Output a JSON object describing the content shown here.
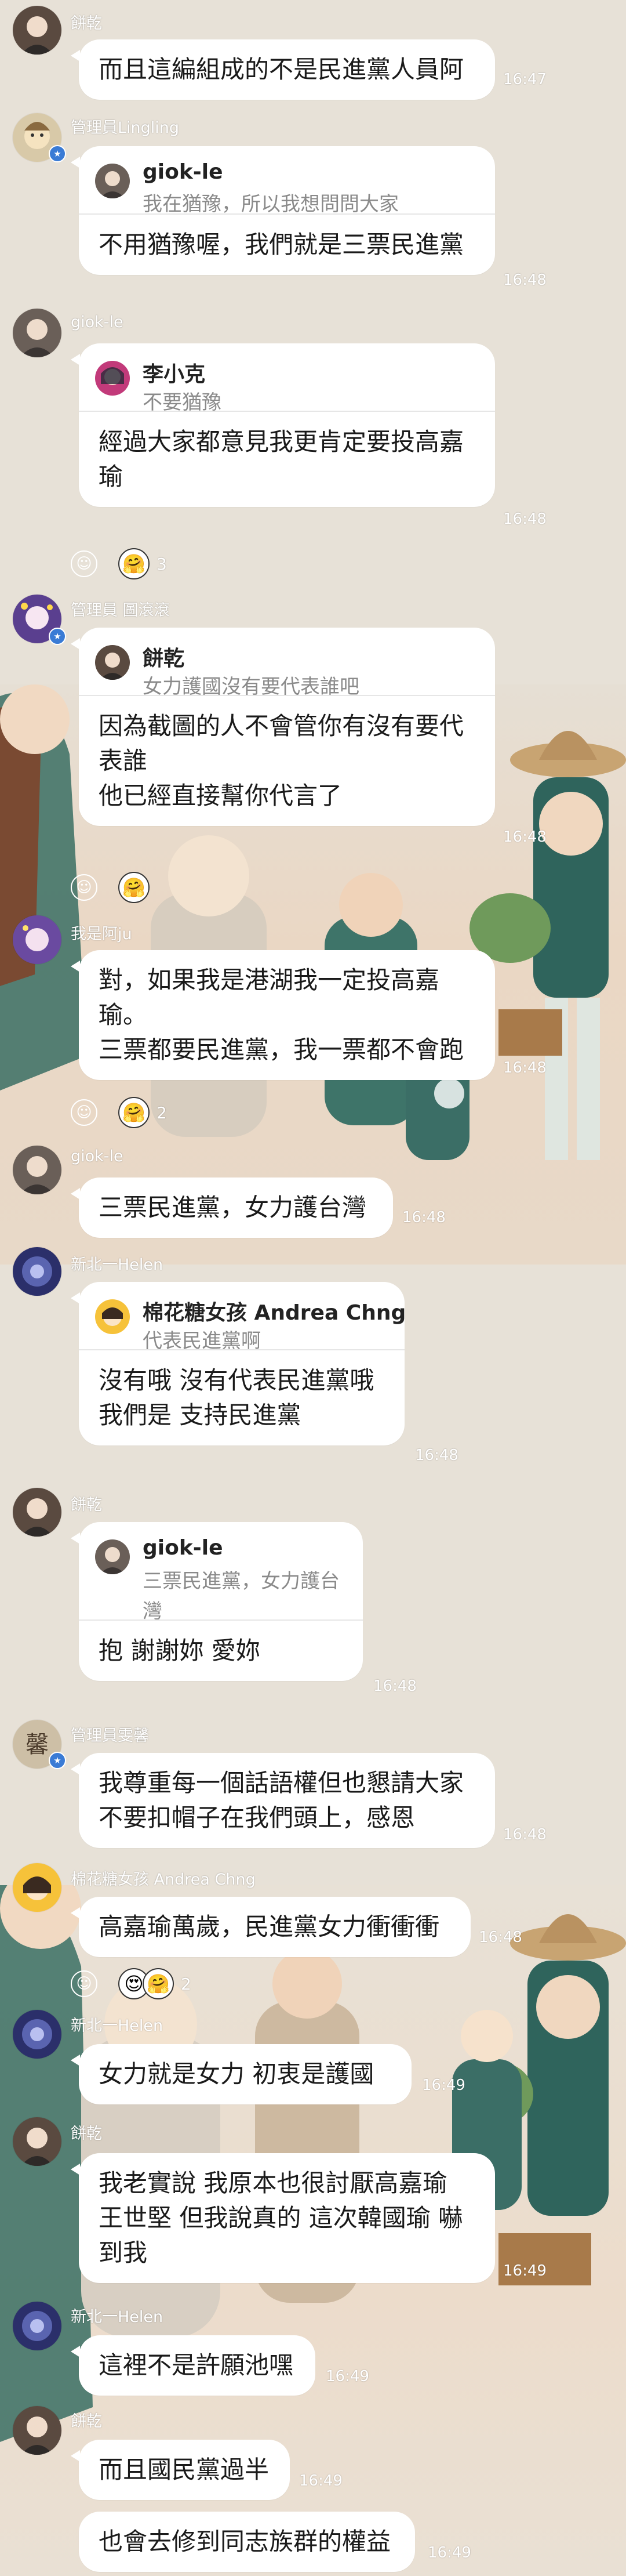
{
  "messages": [
    {
      "sender": "餅乾",
      "text": "而且這編組成的不是民進黨人員阿",
      "time": "16:47"
    },
    {
      "sender": "管理員Lingling",
      "reply": {
        "name": "giok-le",
        "text": "我在猶豫，所以我想問問大家"
      },
      "text": "不用猶豫喔，我們就是三票民進黨",
      "time": "16:48"
    },
    {
      "sender": "giok-le",
      "reply": {
        "name": "李小克",
        "text": "不要猶豫"
      },
      "text": "經過大家都意見我更肯定要投高嘉\n瑜",
      "time": "16:48",
      "reaction_count": "3"
    },
    {
      "sender": "管理員 圖滾滾",
      "reply": {
        "name": "餅乾",
        "text": "女力護國沒有要代表誰吧"
      },
      "text": "因為截圖的人不會管你有沒有要代\n表誰\n他已經直接幫你代言了",
      "time": "16:48"
    },
    {
      "sender": "我是阿ju",
      "text": "對，如果我是港湖我一定投高嘉\n瑜。\n三票都要民進黨，我一票都不會跑",
      "time": "16:48",
      "reaction_count": "2"
    },
    {
      "sender": "giok-le",
      "text": "三票民進黨，女力護台灣",
      "time": "16:48"
    },
    {
      "sender": "新北一Helen",
      "reply": {
        "name": "棉花糖女孩 Andrea Chng",
        "text": "代表民進黨啊"
      },
      "text": "沒有哦  沒有代表民進黨哦\n我們是 支持民進黨",
      "time": "16:48"
    },
    {
      "sender": "餅乾",
      "reply": {
        "name": "giok-le",
        "text": "三票民進黨，女力護台\n灣"
      },
      "text": "抱 謝謝妳 愛妳",
      "time": "16:48"
    },
    {
      "sender": "管理員雯馨",
      "text": "我尊重每一個話語權但也懇請大家\n不要扣帽子在我們頭上，感恩",
      "time": "16:48"
    },
    {
      "sender": "棉花糖女孩 Andrea Chng",
      "text": "高嘉瑜萬歲，民進黨女力衝衝衝",
      "time": "16:48",
      "reaction_count": "2"
    },
    {
      "sender": "新北一Helen",
      "text": "女力就是女力  初衷是護國",
      "time": "16:49"
    },
    {
      "sender": "餅乾",
      "text": "我老實說  我原本也很討厭高嘉瑜\n王世堅  但我說真的 這次韓國瑜 嚇\n到我",
      "time": "16:49"
    },
    {
      "sender": "新北一Helen",
      "text": "這裡不是許願池嘿",
      "time": "16:49"
    },
    {
      "sender": "餅乾",
      "text": "而且國民黨過半",
      "time": "16:49"
    },
    {
      "text": "也會去修到同志族群的權益",
      "time": "16:49"
    }
  ],
  "icons": {
    "add_reaction": "smiley-outline-icon",
    "reaction_hug": "hug-face-icon",
    "reaction_heart": "heart-eyes-icon"
  },
  "colors": {
    "bubble": "#ffffff",
    "background": "#e7e1d7",
    "admin_badge": "#3a7bd5"
  }
}
